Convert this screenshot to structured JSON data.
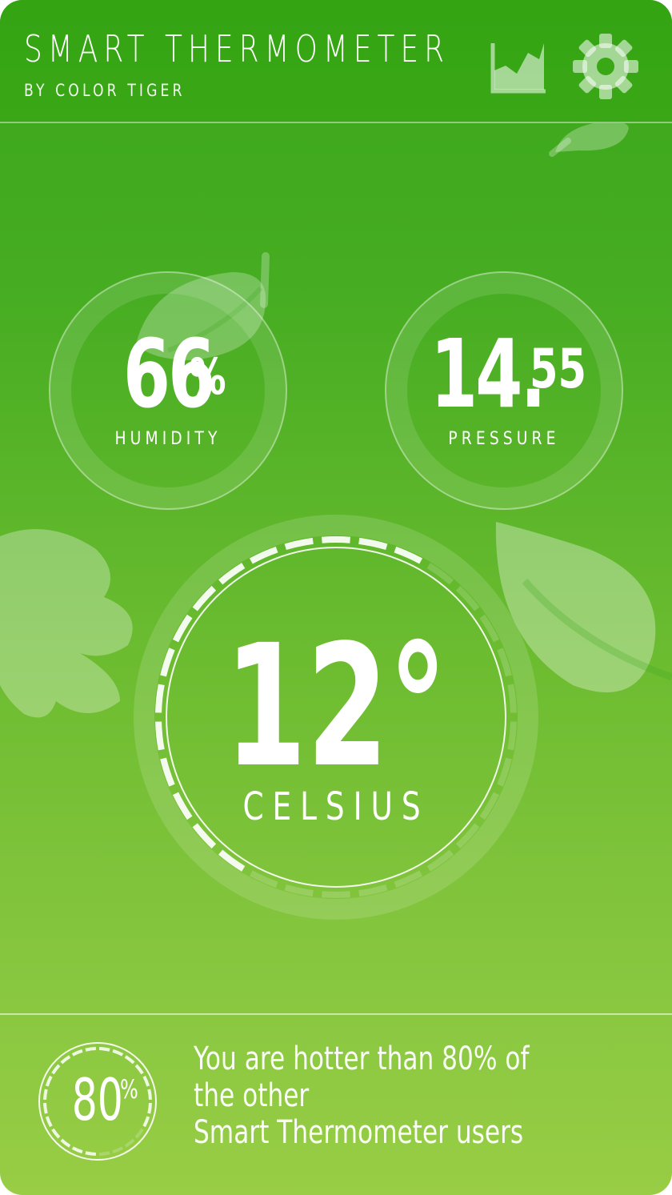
{
  "header": {
    "title": "SMART THERMOMETER",
    "subtitle": "BY COLOR TIGER",
    "chart_icon": "area-chart-icon",
    "settings_icon": "gear-icon"
  },
  "humidity": {
    "value": "66",
    "unit": "%",
    "label": "HUMIDITY",
    "level": 0.66
  },
  "pressure": {
    "value_int": "14.",
    "value_dec": "55",
    "label": "PRESSURE"
  },
  "temperature": {
    "value": "12",
    "degree": "°",
    "unit": "CELSIUS",
    "gauge_fraction": 0.55
  },
  "comparison": {
    "percent": "80",
    "percent_sign": "%",
    "gauge_fraction": 0.8,
    "line1": "You are hotter than 80% of the other",
    "line2": "Smart Thermometer users"
  },
  "colors": {
    "header_green": "#34a413",
    "bottom_green": "#98cd45",
    "text": "#ffffff"
  }
}
